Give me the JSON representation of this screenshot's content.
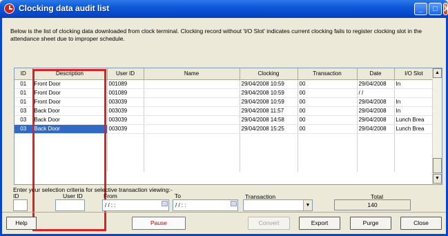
{
  "window": {
    "title": "Clocking data audit list"
  },
  "description": "Below is the list of clocking data downloaded from clock terminal. Clocking record without 'I/O Slot' indicates current clocking fails to register clocking slot in the attendance sheet due to improper schedule.",
  "table": {
    "columns": [
      "ID",
      "Description",
      "User ID",
      "Name",
      "Clocking",
      "Transaction",
      "Date",
      "I/O Slot"
    ],
    "rows": [
      [
        "01",
        "Front Door",
        "001089",
        "",
        "29/04/2008 10:59",
        "00",
        "29/04/2008",
        "In"
      ],
      [
        "01",
        "Front Door",
        "001089",
        "",
        "29/04/2008 10:59",
        "00",
        "/ /",
        ""
      ],
      [
        "01",
        "Front Door",
        "003039",
        "",
        "29/04/2008 10:59",
        "00",
        "29/04/2008",
        "In"
      ],
      [
        "03",
        "Back Door",
        "003039",
        "",
        "29/04/2008 11:57",
        "00",
        "29/04/2008",
        "In"
      ],
      [
        "03",
        "Back Door",
        "003039",
        "",
        "29/04/2008 14:58",
        "00",
        "29/04/2008",
        "Lunch Brea"
      ],
      [
        "03",
        "Back Door",
        "003039",
        "",
        "29/04/2008 15:25",
        "00",
        "29/04/2008",
        "Lunch Brea"
      ]
    ],
    "selected_row_index": 5
  },
  "criteria": {
    "heading": "Enter your selection criteria for selective transaction viewing:-",
    "id_label": "ID",
    "userid_label": "User ID",
    "from_label": "From",
    "to_label": "To",
    "transaction_label": "Transaction",
    "total_label": "Total",
    "from_value": "/ /   : :",
    "to_value": "/ /   : :",
    "total_value": "140"
  },
  "buttons": {
    "help": "Help",
    "pause": "Pause",
    "convert": "Convert",
    "export": "Export",
    "purge": "Purge",
    "close": "Close"
  },
  "colors": {
    "titlebar": "#0a46c9",
    "selection": "#316ac5",
    "highlight_box": "#e02020"
  }
}
